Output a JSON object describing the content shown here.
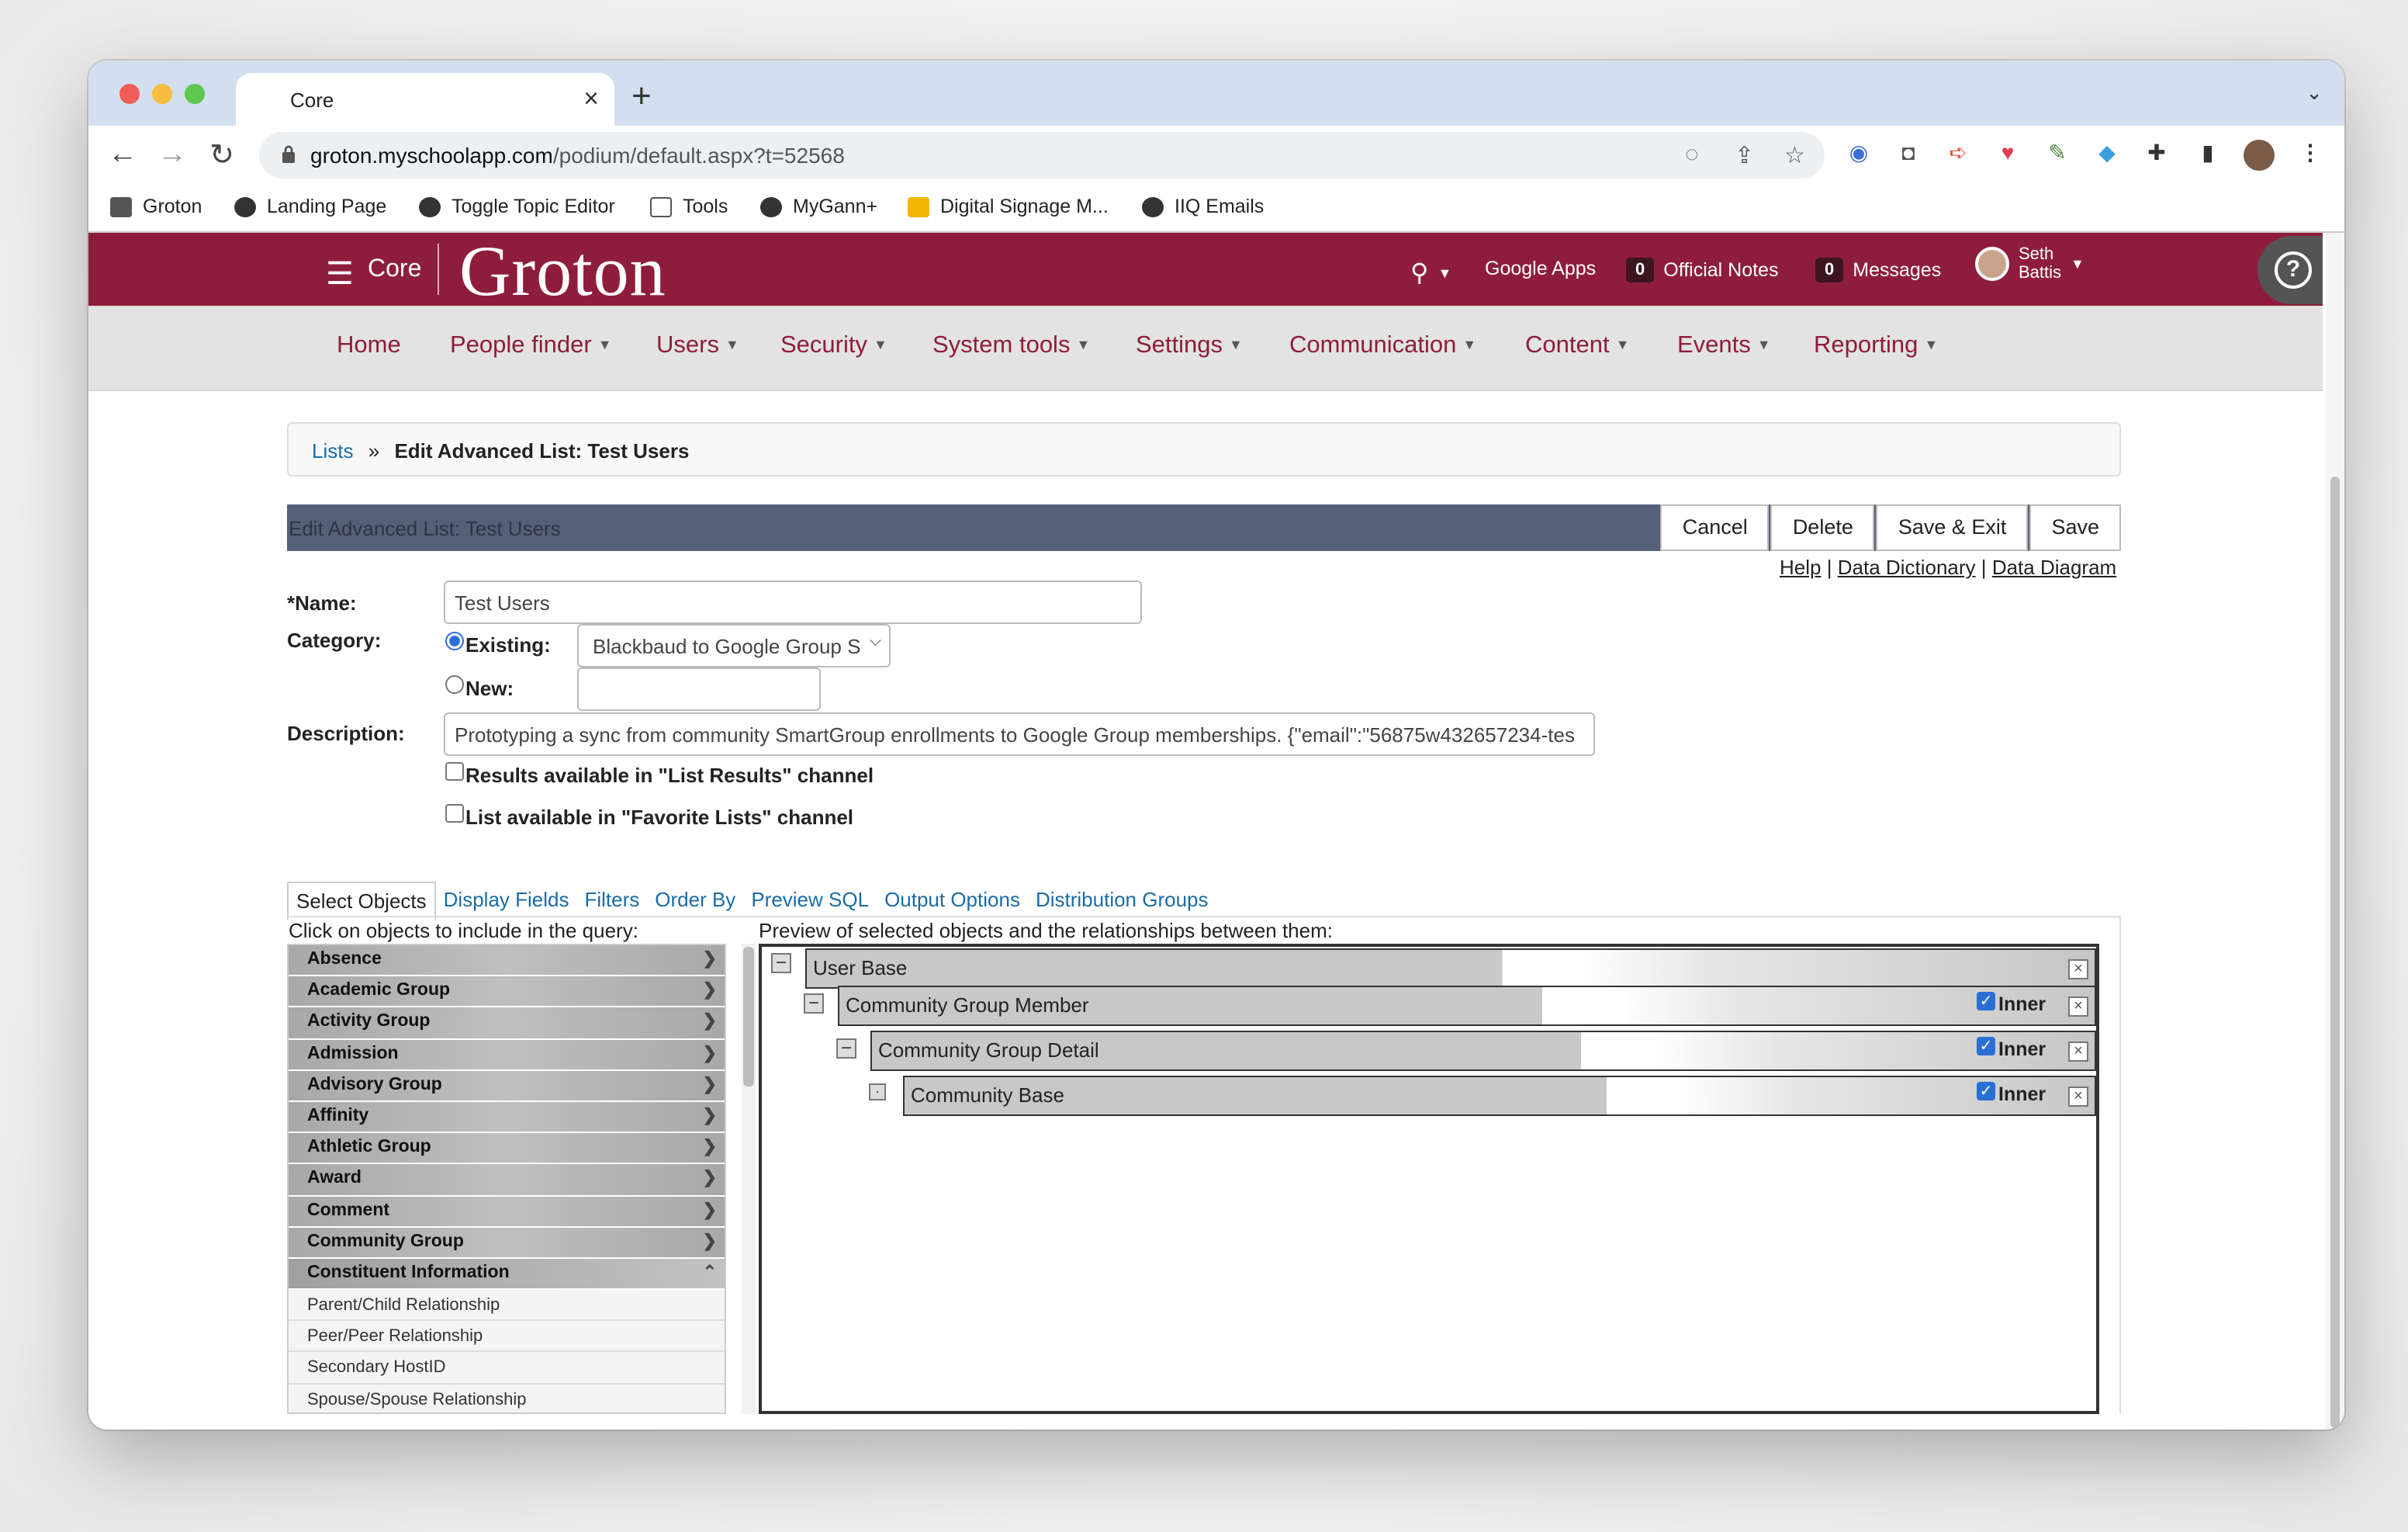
{
  "browser": {
    "tab_title": "Core",
    "url_host": "groton.myschoolapp.com",
    "url_path": "/podium/default.aspx?t=52568",
    "bookmarks": [
      "Groton",
      "Landing Page",
      "Toggle Topic Editor",
      "Tools",
      "MyGann+",
      "Digital Signage M...",
      "IIQ Emails"
    ]
  },
  "site": {
    "app_name": "Core",
    "logo_text": "Groton",
    "google_apps": "Google Apps",
    "official_notes_count": "0",
    "official_notes": "Official Notes",
    "messages_count": "0",
    "messages": "Messages",
    "user_first": "Seth",
    "user_last": "Battis",
    "menu": [
      "Home",
      "People finder",
      "Users",
      "Security",
      "System tools",
      "Settings",
      "Communication",
      "Content",
      "Events",
      "Reporting"
    ]
  },
  "breadcrumb": {
    "link": "Lists",
    "sep": "»",
    "current": "Edit Advanced List: Test Users"
  },
  "editor": {
    "header_title": "Edit Advanced List: Test Users",
    "buttons": {
      "cancel": "Cancel",
      "delete": "Delete",
      "save_exit": "Save & Exit",
      "save": "Save"
    },
    "help_links": {
      "help": "Help",
      "dictionary": "Data Dictionary",
      "diagram": "Data Diagram",
      "sep": "|"
    },
    "name_label": "*Name:",
    "name_value": "Test Users",
    "category_label": "Category:",
    "existing_label": "Existing:",
    "existing_value": "Blackbaud to Google Group S",
    "new_label": "New:",
    "description_label": "Description:",
    "description_value": "Prototyping a sync from community SmartGroup enrollments to Google Group memberships. {\"email\":\"56875w432657234-tes",
    "results_channel_label": "Results available in \"List Results\" channel",
    "favorite_channel_label": "List available in \"Favorite Lists\" channel"
  },
  "object_tabs": [
    "Select Objects",
    "Display Fields",
    "Filters",
    "Order By",
    "Preview SQL",
    "Output Options",
    "Distribution Groups"
  ],
  "left_panel": {
    "instruction": "Click on objects to include in the query:",
    "objects": [
      "Absence",
      "Academic Group",
      "Activity Group",
      "Admission",
      "Advisory Group",
      "Affinity",
      "Athletic Group",
      "Award",
      "Comment",
      "Community Group",
      "Constituent Information"
    ],
    "expanded_items": [
      "Parent/Child Relationship",
      "Peer/Peer Relationship",
      "Secondary HostID",
      "Spouse/Spouse Relationship"
    ]
  },
  "preview": {
    "instruction": "Preview of selected objects and the relationships between them:",
    "nodes": [
      {
        "label": "User Base",
        "join": ""
      },
      {
        "label": "Community Group Member",
        "join": "Inner"
      },
      {
        "label": "Community Group Detail",
        "join": "Inner"
      },
      {
        "label": "Community Base",
        "join": "Inner"
      }
    ]
  },
  "colors": {
    "brand": "#8e1d3b",
    "link": "#1a6ca8",
    "header_bar": "#555f77"
  }
}
